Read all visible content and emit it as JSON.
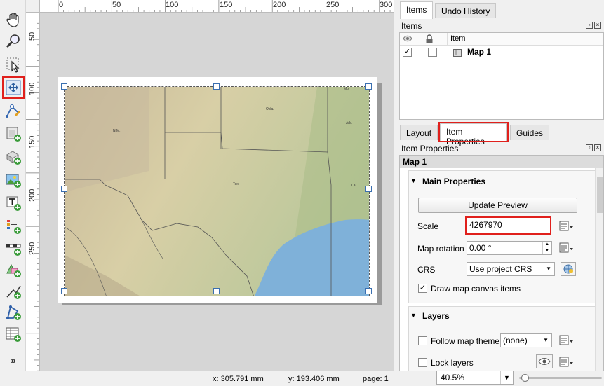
{
  "toolbar": {
    "tools": [
      {
        "name": "pan-layout-tool"
      },
      {
        "name": "zoom-tool"
      },
      {
        "name": "select-move-item-tool"
      },
      {
        "name": "move-item-content-tool"
      },
      {
        "name": "edit-nodes-tool"
      },
      {
        "name": "add-map-tool"
      },
      {
        "name": "add-3d-map-tool"
      },
      {
        "name": "add-picture-tool"
      },
      {
        "name": "add-label-tool"
      },
      {
        "name": "add-legend-tool"
      },
      {
        "name": "add-scalebar-tool"
      },
      {
        "name": "add-shape-tool"
      },
      {
        "name": "add-polyline-tool"
      },
      {
        "name": "add-polygon-tool"
      },
      {
        "name": "add-attribute-table-tool"
      }
    ],
    "more": "»"
  },
  "rulers": {
    "h_labels": [
      "0",
      "50",
      "100",
      "150",
      "200",
      "250",
      "300"
    ],
    "v_labels": [
      "50",
      "100",
      "150",
      "200",
      "250"
    ]
  },
  "map": {
    "place_labels": [
      "N.M.",
      "Okla.",
      "Ark.",
      "Tex.",
      "La.",
      "Mo."
    ]
  },
  "status": {
    "x": "x: 305.791 mm",
    "y": "y: 193.406 mm",
    "page": "page: 1",
    "zoom": "40.5%",
    "zoom_level": 0.03
  },
  "items_panel": {
    "tabs": [
      "Items",
      "Undo History"
    ],
    "active_tab": "Items",
    "title": "Items",
    "column_item": "Item",
    "rows": [
      {
        "visible": true,
        "locked": false,
        "name": "Map 1"
      }
    ]
  },
  "props_panel": {
    "tabs": [
      "Layout",
      "Item Properties",
      "Guides"
    ],
    "active_tab": "Item Properties",
    "title": "Item Properties",
    "item_name": "Map 1",
    "main_props_title": "Main Properties",
    "update_preview": "Update Preview",
    "scale_label": "Scale",
    "scale_value": "4267970",
    "rotation_label": "Map rotation",
    "rotation_value": "0.00 °",
    "crs_label": "CRS",
    "crs_value": "Use project CRS",
    "draw_canvas_items": "Draw map canvas items",
    "layers_title": "Layers",
    "follow_theme": "Follow map theme",
    "theme_value": "(none)",
    "lock_layers": "Lock layers"
  },
  "colors": {
    "highlight": "#e0201c",
    "water": "#7fb1d9",
    "selection": "#3a6fb0"
  }
}
